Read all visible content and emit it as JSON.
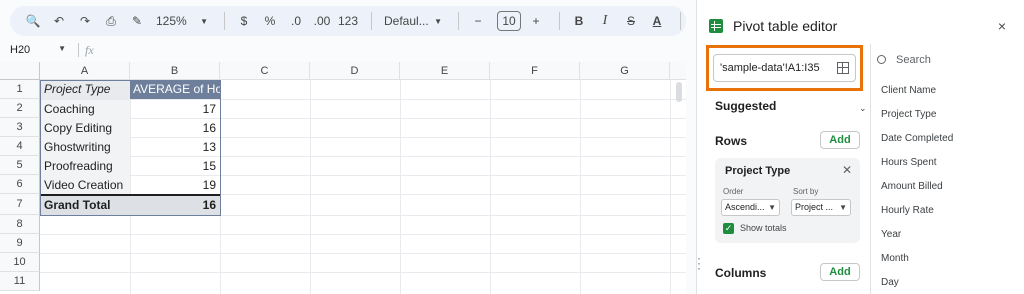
{
  "toolbar": {
    "zoom": "125%",
    "currency": "$",
    "percent": "%",
    "dec_decrease": ".0",
    "dec_increase": ".00",
    "number_format": "123",
    "font": "Defaul...",
    "font_size": "10",
    "minus": "−",
    "plus": "+",
    "bold": "B",
    "italic": "I",
    "strike": "S",
    "text_color": "A"
  },
  "name_box": "H20",
  "fx": "fx",
  "columns": [
    "A",
    "B",
    "C",
    "D",
    "E",
    "F",
    "G"
  ],
  "rows": [
    "1",
    "2",
    "3",
    "4",
    "5",
    "6",
    "7",
    "8",
    "9",
    "10",
    "11"
  ],
  "pivot": {
    "header_a": "Project Type",
    "header_b": "AVERAGE of Ho",
    "items": [
      {
        "label": "Coaching",
        "value": "17"
      },
      {
        "label": "Copy Editing",
        "value": "16"
      },
      {
        "label": "Ghostwriting",
        "value": "13"
      },
      {
        "label": "Proofreading",
        "value": "15"
      },
      {
        "label": "Video Creation",
        "value": "19"
      }
    ],
    "total_label": "Grand Total",
    "total_value": "16"
  },
  "panel": {
    "title": "Pivot table editor",
    "close": "×",
    "range": "'sample-data'!A1:I35",
    "suggested": "Suggested",
    "rows_label": "Rows",
    "add": "Add",
    "columns_label": "Columns",
    "row_card": {
      "title": "Project Type",
      "order_label": "Order",
      "order_value": "Ascendi...",
      "sortby_label": "Sort by",
      "sortby_value": "Project ...",
      "show_totals": "Show totals"
    },
    "search_placeholder": "Search",
    "fields": [
      "Client Name",
      "Project Type",
      "Date Completed",
      "Hours Spent",
      "Amount Billed",
      "Hourly Rate",
      "Year",
      "Month",
      "Day"
    ]
  },
  "colors": {
    "pivot_header": "#6d7f9b",
    "accent_green": "#1e8e3e",
    "highlight": "#e8710a"
  }
}
